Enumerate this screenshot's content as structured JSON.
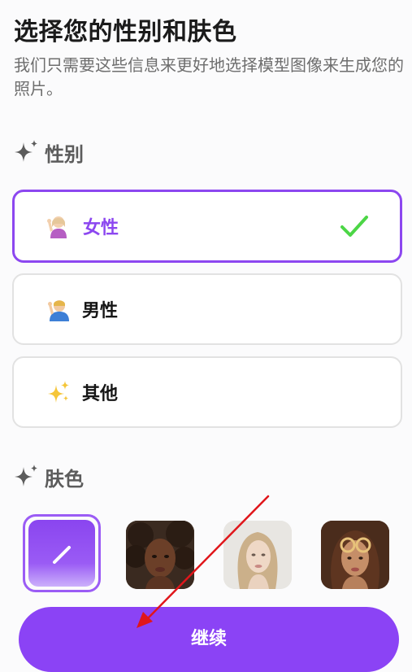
{
  "header": {
    "title": "选择您的性别和肤色",
    "subtitle": "我们只需要这些信息来更好地选择模型图像来生成您的照片。"
  },
  "gender_section": {
    "label": "性别",
    "icon": "sparkle-icon",
    "options": [
      {
        "label": "女性",
        "emoji": "woman-raising-hand-icon",
        "selected": true
      },
      {
        "label": "男性",
        "emoji": "man-raising-hand-icon",
        "selected": false
      },
      {
        "label": "其他",
        "emoji": "sparkles-icon",
        "selected": false
      }
    ],
    "check_icon": "checkmark-icon"
  },
  "skin_section": {
    "label": "肤色",
    "icon": "sparkle-icon",
    "swatches": [
      {
        "name": "custom-tone",
        "icon": "pencil-icon",
        "selected": true
      },
      {
        "name": "dark-tone",
        "selected": false
      },
      {
        "name": "light-tone",
        "selected": false
      },
      {
        "name": "medium-tone",
        "selected": false
      }
    ]
  },
  "footer": {
    "continue_label": "继续"
  },
  "colors": {
    "accent": "#8b43f5",
    "check": "#4cd646",
    "border": "#e2e2e2",
    "annotation_arrow": "#e0161b"
  }
}
